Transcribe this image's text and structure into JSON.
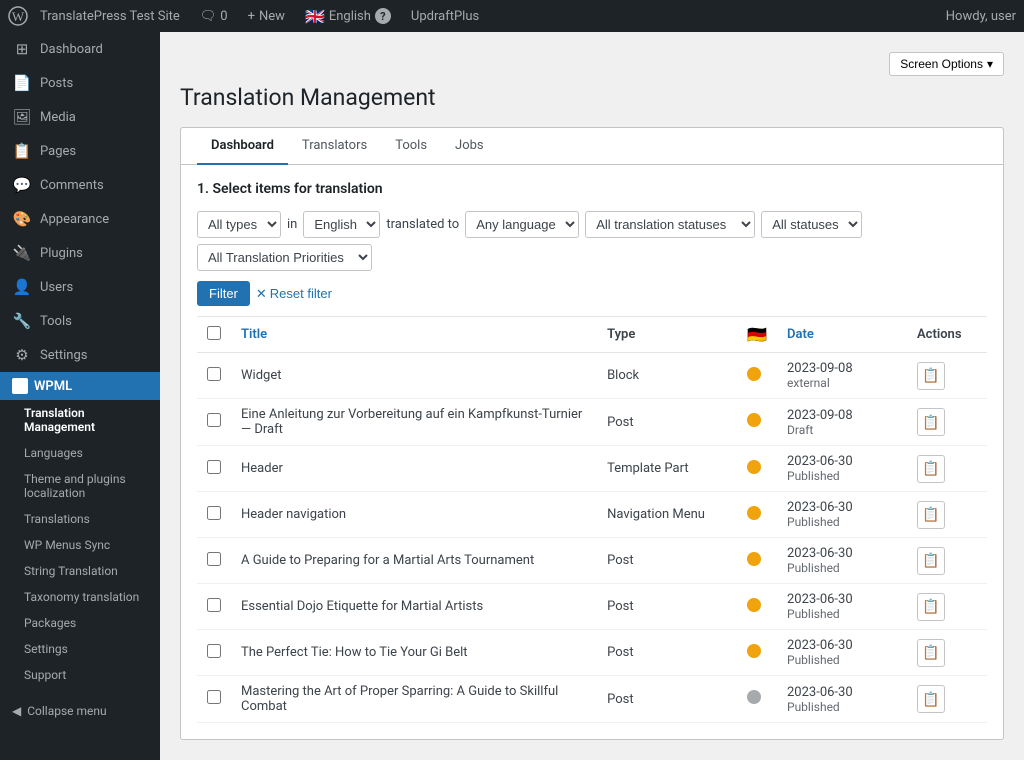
{
  "adminbar": {
    "site_name": "TranslatePress Test Site",
    "comments_count": "0",
    "new_label": "New",
    "language_flag": "🇬🇧",
    "language_label": "English",
    "help_label": "?",
    "plugin_label": "UpdraftPlus",
    "howdy": "Howdy, user",
    "screen_options": "Screen Options"
  },
  "sidebar": {
    "items": [
      {
        "id": "dashboard",
        "label": "Dashboard",
        "icon": "⊞"
      },
      {
        "id": "posts",
        "label": "Posts",
        "icon": "📄"
      },
      {
        "id": "media",
        "label": "Media",
        "icon": "🖼"
      },
      {
        "id": "pages",
        "label": "Pages",
        "icon": "📋"
      },
      {
        "id": "comments",
        "label": "Comments",
        "icon": "💬"
      },
      {
        "id": "appearance",
        "label": "Appearance",
        "icon": "🎨"
      },
      {
        "id": "plugins",
        "label": "Plugins",
        "icon": "🔌"
      },
      {
        "id": "users",
        "label": "Users",
        "icon": "👤"
      },
      {
        "id": "tools",
        "label": "Tools",
        "icon": "🔧"
      },
      {
        "id": "settings",
        "label": "Settings",
        "icon": "⚙"
      }
    ],
    "wpml_label": "WPML",
    "submenu": [
      {
        "id": "translation-management",
        "label": "Translation Management",
        "active": true
      },
      {
        "id": "languages",
        "label": "Languages"
      },
      {
        "id": "theme-plugins-localization",
        "label": "Theme and plugins localization"
      },
      {
        "id": "translations",
        "label": "Translations"
      },
      {
        "id": "wp-menus-sync",
        "label": "WP Menus Sync"
      },
      {
        "id": "string-translation",
        "label": "String Translation"
      },
      {
        "id": "taxonomy-translation",
        "label": "Taxonomy translation"
      },
      {
        "id": "packages",
        "label": "Packages"
      },
      {
        "id": "settings",
        "label": "Settings"
      },
      {
        "id": "support",
        "label": "Support"
      }
    ],
    "collapse_label": "Collapse menu"
  },
  "page": {
    "title": "Translation Management",
    "tabs": [
      {
        "id": "dashboard",
        "label": "Dashboard",
        "active": true
      },
      {
        "id": "translators",
        "label": "Translators"
      },
      {
        "id": "tools",
        "label": "Tools"
      },
      {
        "id": "jobs",
        "label": "Jobs"
      }
    ],
    "section_title": "1. Select items for translation",
    "filters": {
      "type_options": [
        "All types"
      ],
      "type_selected": "All types",
      "in_label": "in",
      "language_options": [
        "English"
      ],
      "language_selected": "English",
      "translated_to_label": "translated to",
      "any_language_options": [
        "Any language"
      ],
      "any_language_selected": "Any language",
      "translation_status_options": [
        "All translation statuses"
      ],
      "translation_status_selected": "All translation statuses",
      "status_options": [
        "All statuses"
      ],
      "status_selected": "All statuses",
      "priority_options": [
        "All Translation Priorities"
      ],
      "priority_selected": "All Translation Priorities",
      "filter_btn": "Filter",
      "reset_btn": "Reset filter"
    },
    "table": {
      "columns": [
        {
          "id": "cb",
          "label": ""
        },
        {
          "id": "title",
          "label": "Title",
          "sortable": true
        },
        {
          "id": "type",
          "label": "Type"
        },
        {
          "id": "de_flag",
          "label": "🇩🇪"
        },
        {
          "id": "date",
          "label": "Date",
          "sortable": true
        },
        {
          "id": "actions",
          "label": "Actions"
        }
      ],
      "rows": [
        {
          "id": 1,
          "title": "Widget",
          "type": "Block",
          "status": "orange",
          "date": "2023-09-08",
          "date_label": "external"
        },
        {
          "id": 2,
          "title": "Eine Anleitung zur Vorbereitung auf ein Kampfkunst-Turnier — Draft",
          "type": "Post",
          "status": "orange",
          "date": "2023-09-08",
          "date_label": "Draft"
        },
        {
          "id": 3,
          "title": "Header",
          "type": "Template Part",
          "status": "orange",
          "date": "2023-06-30",
          "date_label": "Published"
        },
        {
          "id": 4,
          "title": "Header navigation",
          "type": "Navigation Menu",
          "status": "orange",
          "date": "2023-06-30",
          "date_label": "Published"
        },
        {
          "id": 5,
          "title": "A Guide to Preparing for a Martial Arts Tournament",
          "type": "Post",
          "status": "orange",
          "date": "2023-06-30",
          "date_label": "Published"
        },
        {
          "id": 6,
          "title": "Essential Dojo Etiquette for Martial Artists",
          "type": "Post",
          "status": "orange",
          "date": "2023-06-30",
          "date_label": "Published"
        },
        {
          "id": 7,
          "title": "The Perfect Tie: How to Tie Your Gi Belt",
          "type": "Post",
          "status": "orange",
          "date": "2023-06-30",
          "date_label": "Published"
        },
        {
          "id": 8,
          "title": "Mastering the Art of Proper Sparring: A Guide to Skillful Combat",
          "type": "Post",
          "status": "gray",
          "date": "2023-06-30",
          "date_label": "Published"
        }
      ]
    }
  }
}
